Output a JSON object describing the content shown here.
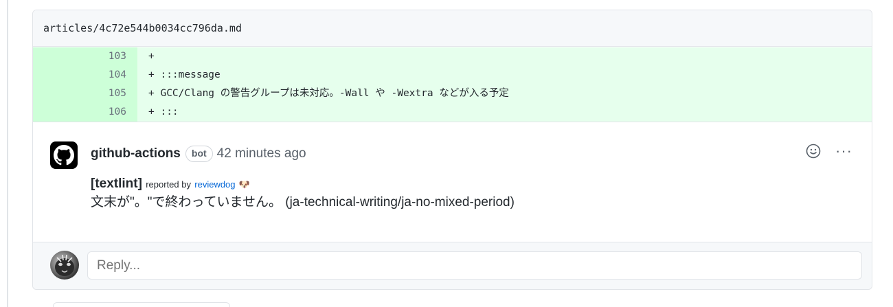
{
  "file": {
    "path": "articles/4c72e544b0034cc796da.md"
  },
  "diff": {
    "lines": [
      {
        "num": "103",
        "code": "+"
      },
      {
        "num": "104",
        "code": "+ :::message"
      },
      {
        "num": "105",
        "code": "+ GCC/Clang の警告グループは未対応。-Wall や -Wextra などが入る予定"
      },
      {
        "num": "106",
        "code": "+ :::"
      }
    ]
  },
  "comment": {
    "author": "github-actions",
    "badge": "bot",
    "time": "42 minutes ago",
    "avatar_icon": "github-octocat-icon",
    "tag": "[textlint]",
    "reported_by": "reported by",
    "reviewer_link": "reviewdog",
    "reviewer_emoji": "🐶",
    "message": "文末が\"。\"で終わっていません。 (ja-technical-writing/ja-no-mixed-period)",
    "actions": {
      "emoji_icon": "smiley-icon",
      "more": "···"
    }
  },
  "reply": {
    "placeholder": "Reply..."
  },
  "colors": {
    "added_line_bg": "#e6ffed",
    "added_num_bg": "#cdffd8",
    "link": "#0366d6",
    "border": "#e1e4e8"
  }
}
